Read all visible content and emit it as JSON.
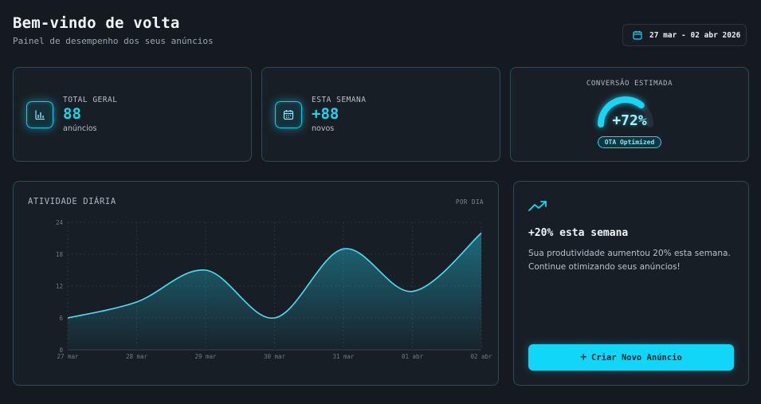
{
  "header": {
    "title": "Bem-vindo de volta",
    "subtitle": "Painel de desempenho dos seus anúncios",
    "date_range": "27 mar - 02 abr 2026"
  },
  "stats": {
    "total": {
      "label": "TOTAL GERAL",
      "value": "88",
      "sub": "anúncios",
      "icon": "bar-chart-icon"
    },
    "week": {
      "label": "ESTA SEMANA",
      "value": "+88",
      "sub": "novos",
      "icon": "calendar-icon"
    },
    "conversion": {
      "label": "CONVERSÃO ESTIMADA",
      "value": "+72%",
      "badge": "OTA Optimized",
      "gauge_fraction": 0.72
    }
  },
  "activity": {
    "title": "ATIVIDADE DIÁRIA",
    "note": "POR DIA"
  },
  "insight": {
    "icon": "trending-up-icon",
    "title": "+20% esta semana",
    "text": "Sua produtividade aumentou 20% esta semana. Continue otimizando seus anúncios!",
    "button": "Criar Novo Anúncio",
    "button_icon": "plus-icon"
  },
  "colors": {
    "accent": "#22d3ee",
    "background": "#151a21",
    "card": "#181e26",
    "border": "#2c4a55"
  },
  "chart_data": {
    "type": "area",
    "categories": [
      "27 mar",
      "28 mar",
      "29 mar",
      "30 mar",
      "31 mar",
      "01 abr",
      "02 abr"
    ],
    "values": [
      6,
      9,
      15,
      6,
      19,
      11,
      22
    ],
    "ylim": [
      0,
      24
    ],
    "yticks": [
      0,
      6,
      12,
      18,
      24
    ],
    "grid": true,
    "title": "ATIVIDADE DIÁRIA"
  }
}
